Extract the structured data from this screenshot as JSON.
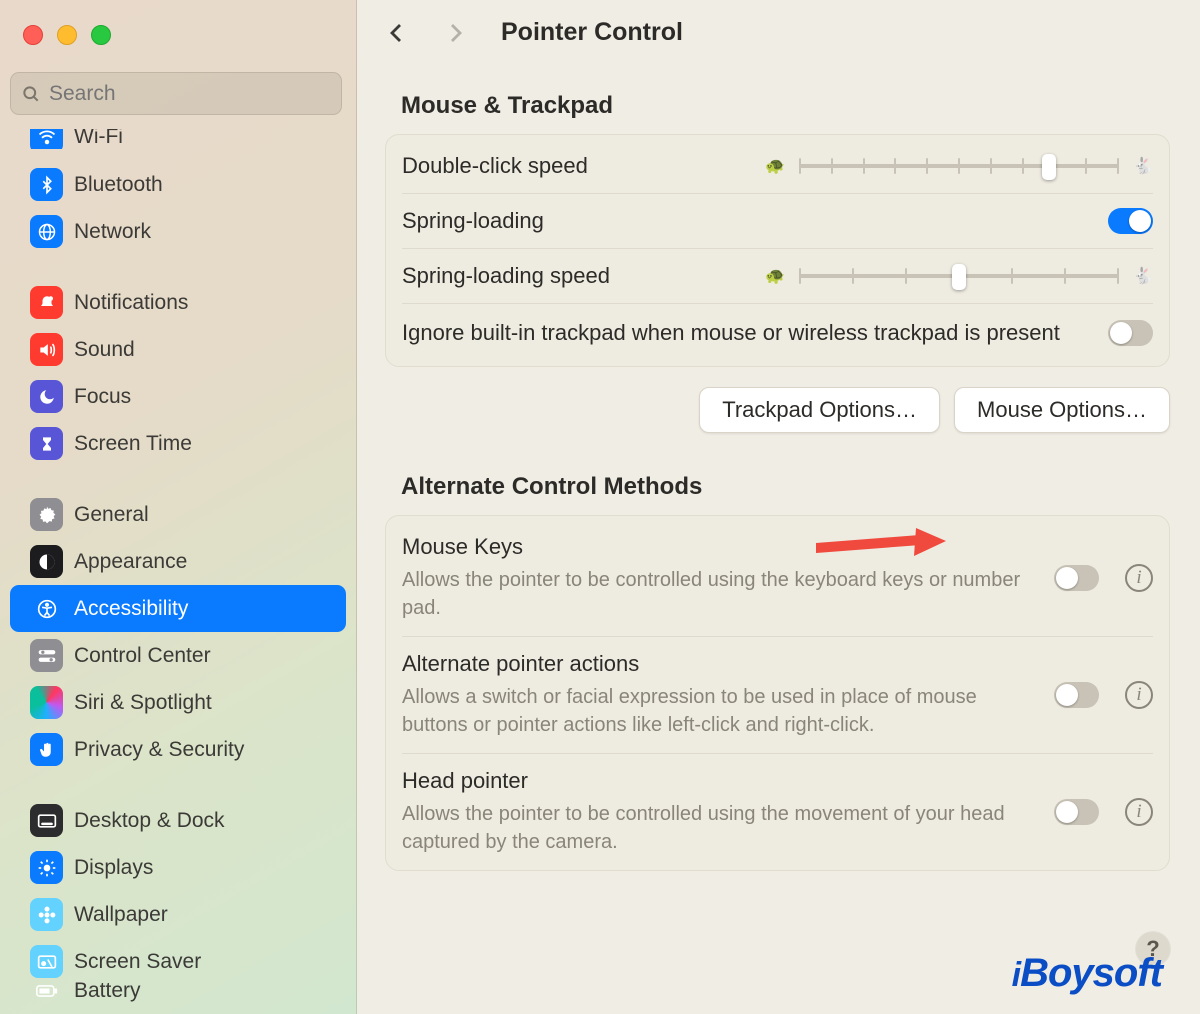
{
  "search": {
    "placeholder": "Search"
  },
  "sidebar": [
    {
      "id": "wifi",
      "label": "Wi-Fi",
      "icon": "wifi-icon",
      "cls": "ic-blue",
      "cut": true
    },
    {
      "id": "bluetooth",
      "label": "Bluetooth",
      "icon": "bluetooth-icon",
      "cls": "ic-blue"
    },
    {
      "id": "network",
      "label": "Network",
      "icon": "globe-icon",
      "cls": "ic-blue"
    },
    {
      "gap": true
    },
    {
      "id": "notifications",
      "label": "Notifications",
      "icon": "bell-icon",
      "cls": "ic-red"
    },
    {
      "id": "sound",
      "label": "Sound",
      "icon": "speaker-icon",
      "cls": "ic-red"
    },
    {
      "id": "focus",
      "label": "Focus",
      "icon": "moon-icon",
      "cls": "ic-purple"
    },
    {
      "id": "screentime",
      "label": "Screen Time",
      "icon": "hourglass-icon",
      "cls": "ic-purple"
    },
    {
      "gap": true
    },
    {
      "id": "general",
      "label": "General",
      "icon": "gear-icon",
      "cls": "ic-grey"
    },
    {
      "id": "appearance",
      "label": "Appearance",
      "icon": "appearance-icon",
      "cls": "ic-black"
    },
    {
      "id": "accessibility",
      "label": "Accessibility",
      "icon": "accessibility-icon",
      "cls": "ic-blue",
      "selected": true
    },
    {
      "id": "controlcenter",
      "label": "Control Center",
      "icon": "switches-icon",
      "cls": "ic-grey"
    },
    {
      "id": "siri",
      "label": "Siri & Spotlight",
      "icon": "siri-icon",
      "cls": "ic-siri"
    },
    {
      "id": "privacy",
      "label": "Privacy & Security",
      "icon": "hand-icon",
      "cls": "ic-blue"
    },
    {
      "gap": true
    },
    {
      "id": "desktop",
      "label": "Desktop & Dock",
      "icon": "dock-icon",
      "cls": "ic-dark"
    },
    {
      "id": "displays",
      "label": "Displays",
      "icon": "sun-icon",
      "cls": "ic-blue"
    },
    {
      "id": "wallpaper",
      "label": "Wallpaper",
      "icon": "flower-icon",
      "cls": "ic-teal"
    },
    {
      "id": "screensaver",
      "label": "Screen Saver",
      "icon": "screensaver-icon",
      "cls": "ic-teal"
    },
    {
      "id": "battery",
      "label": "Battery",
      "icon": "battery-icon",
      "cls": "ic-green",
      "cut": true
    }
  ],
  "page": {
    "title": "Pointer Control",
    "sections": {
      "mouse_trackpad": {
        "heading": "Mouse & Trackpad",
        "rows": {
          "double_click": {
            "label": "Double-click speed",
            "value": 0.78,
            "ticks": 11
          },
          "spring_loading": {
            "label": "Spring-loading",
            "on": true
          },
          "spring_speed": {
            "label": "Spring-loading speed",
            "value": 0.5,
            "ticks": 7
          },
          "ignore_trackpad": {
            "label": "Ignore built-in trackpad when mouse or wireless trackpad is present",
            "on": false
          }
        },
        "buttons": {
          "trackpad": "Trackpad Options…",
          "mouse": "Mouse Options…"
        }
      },
      "alternate": {
        "heading": "Alternate Control Methods",
        "rows": {
          "mouse_keys": {
            "label": "Mouse Keys",
            "desc": "Allows the pointer to be controlled using the keyboard keys or number pad.",
            "on": false
          },
          "alt_pointer": {
            "label": "Alternate pointer actions",
            "desc": "Allows a switch or facial expression to be used in place of mouse buttons or pointer actions like left-click and right-click.",
            "on": false
          },
          "head_pointer": {
            "label": "Head pointer",
            "desc": "Allows the pointer to be controlled using the movement of your head captured by the camera.",
            "on": false
          }
        }
      }
    }
  },
  "watermark": "iBoysoft"
}
